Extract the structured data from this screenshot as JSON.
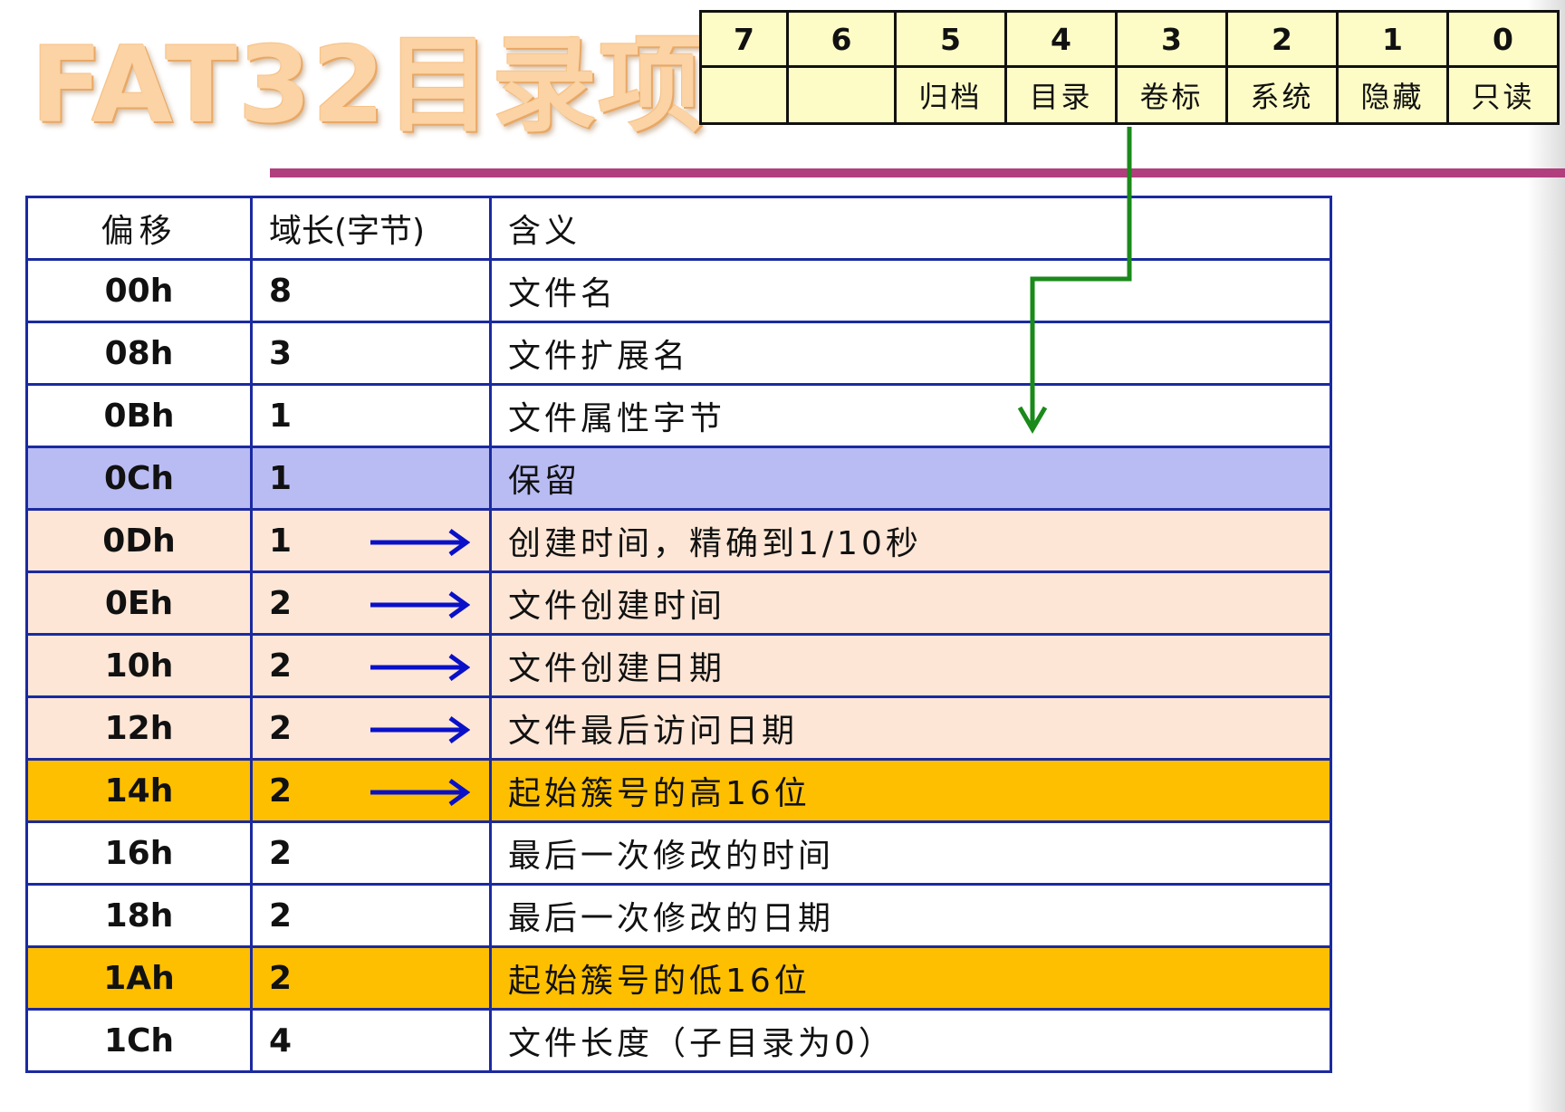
{
  "title": "FAT32目录项",
  "attribute_byte": {
    "bits": [
      "7",
      "6",
      "5",
      "4",
      "3",
      "2",
      "1",
      "0"
    ],
    "names": [
      "",
      "",
      "归档",
      "目录",
      "卷标",
      "系统",
      "隐藏",
      "只读"
    ]
  },
  "table": {
    "headers": {
      "offset": "偏移",
      "length": "域长(字节)",
      "meaning": "含义"
    },
    "rows": [
      {
        "offset": "00h",
        "length": "8",
        "meaning": "文件名",
        "style": "white",
        "arrow": false
      },
      {
        "offset": "08h",
        "length": "3",
        "meaning": "文件扩展名",
        "style": "white",
        "arrow": false
      },
      {
        "offset": "0Bh",
        "length": "1",
        "meaning": "文件属性字节",
        "style": "white",
        "arrow": false
      },
      {
        "offset": "0Ch",
        "length": "1",
        "meaning": "保留",
        "style": "purple",
        "arrow": false
      },
      {
        "offset": "0Dh",
        "length": "1",
        "meaning": "创建时间，精确到1/10秒",
        "style": "peach",
        "arrow": true
      },
      {
        "offset": "0Eh",
        "length": "2",
        "meaning": "文件创建时间",
        "style": "peach",
        "arrow": true
      },
      {
        "offset": "10h",
        "length": "2",
        "meaning": "文件创建日期",
        "style": "peach",
        "arrow": true
      },
      {
        "offset": "12h",
        "length": "2",
        "meaning": "文件最后访问日期",
        "style": "peach",
        "arrow": true
      },
      {
        "offset": "14h",
        "length": "2",
        "meaning": "起始簇号的高16位",
        "style": "orange",
        "arrow": true
      },
      {
        "offset": "16h",
        "length": "2",
        "meaning": "最后一次修改的时间",
        "style": "white",
        "arrow": false
      },
      {
        "offset": "18h",
        "length": "2",
        "meaning": "最后一次修改的日期",
        "style": "white",
        "arrow": false
      },
      {
        "offset": "1Ah",
        "length": "2",
        "meaning": "起始簇号的低16位",
        "style": "orange",
        "arrow": false
      },
      {
        "offset": "1Ch",
        "length": "4",
        "meaning": "文件长度（子目录为0）",
        "style": "white",
        "arrow": false
      }
    ]
  },
  "colors": {
    "border": "#1b2aa0",
    "arrow_blue": "#0a10c8",
    "pointer_green": "#1a8a1a",
    "accent_line": "#b13f7e"
  }
}
